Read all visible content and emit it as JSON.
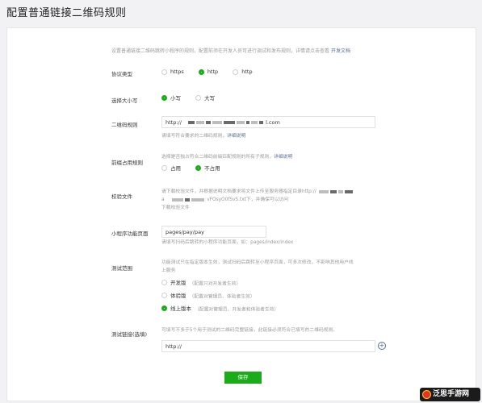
{
  "page": {
    "title": "配置普通链接二维码规则"
  },
  "intro": {
    "text": "设置普通链接二维码跳转小程序的规则，配置前须在开发人员可进行调试和发布规则，详情请点击查看",
    "link": "开发文档"
  },
  "protocol": {
    "label": "协议类型",
    "options": [
      {
        "label": "https",
        "checked": false
      },
      {
        "label": "http",
        "checked": true
      },
      {
        "label": "http",
        "checked": false
      }
    ]
  },
  "case": {
    "label": "选择大小写",
    "options": [
      {
        "label": "小写",
        "checked": true
      },
      {
        "label": "大写",
        "checked": false
      }
    ]
  },
  "qr_rule": {
    "label": "二维码规则",
    "prefix": "http://",
    "suffix": "l.com",
    "hint": "请填写符合要求的二维码规则，",
    "hint_link": "详细说明"
  },
  "prefix_rule": {
    "label": "前缀占用规则",
    "hint": "选择是否独占符合二维码前缀匹配规则的所有子规则，",
    "hint_link": "详细说明",
    "options": [
      {
        "label": "占用",
        "checked": false
      },
      {
        "label": "不占用",
        "checked": true
      }
    ]
  },
  "verify": {
    "label": "校验文件",
    "line1": "请下载校验文件，并根据说明文档要求将文件上传至服务器指定目录http://",
    "line2_suffix": "vFOsyO0fSvS.txt下，并确保可以访问",
    "line2_prefix": "a",
    "download_link": "下载校验文件"
  },
  "page_path": {
    "label": "小程序功能页面",
    "value": "pages/pay/pay",
    "hint": "请填写扫码后跳转的小程序功能页面，如：pages/index/index"
  },
  "test_scope": {
    "label": "测试范围",
    "hint_line1": "功能测试只在指定版本生效，测试扫码后跳转至小程序页面，可多次修改，不影响其他用户线",
    "hint_line2": "上服务",
    "options": [
      {
        "label": "开发版",
        "note": "（配置只对开发者生效）",
        "checked": false
      },
      {
        "label": "体验版",
        "note": "（配置对管理员、体验者生效）",
        "checked": false
      },
      {
        "label": "线上版本",
        "note": "（配置对管理员、开发者和体验者生效）",
        "checked": true
      }
    ]
  },
  "test_link": {
    "label": "测试链接(选填)",
    "hint": "可填写不多于5个用于测试的二维码完整链接，此链接必须符合已填写的二维码规则。",
    "value": "http://"
  },
  "save_label": "保存",
  "watermark": "泛思手游网",
  "colors": {
    "accent": "#1aad19",
    "link": "#576b95"
  }
}
